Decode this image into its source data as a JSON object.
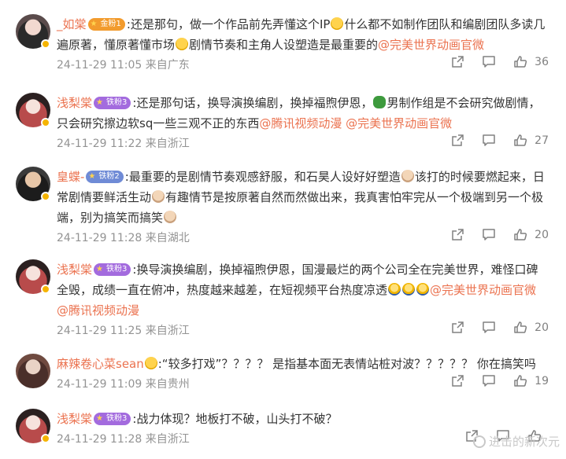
{
  "comments": [
    {
      "user": "_如棠",
      "badge": "金粉1",
      "badge_color": "#f29b2d",
      "segments": [
        {
          "t": ":还是那句，做一个作品前先弄懂这个IP"
        },
        {
          "e": "cry-icon"
        },
        {
          "t": "什么都不如制作团队和编剧团队多读几遍原著，懂原著懂市场"
        },
        {
          "e": "sad-icon"
        },
        {
          "t": "剧情节奏和主角人设塑造是最重要的"
        },
        {
          "m": "@完美世界动画官微"
        }
      ],
      "time": "24-11-29 11:05 来自广东",
      "likes": "36"
    },
    {
      "user": "浅梨棠",
      "badge": "铁粉3",
      "badge_color": "#a36bde",
      "segments": [
        {
          "t": ":还是那句话，换导演换编剧，换掉福煦伊恩，"
        },
        {
          "e": "turtle-icon"
        },
        {
          "t": "男制作组是不会研究做剧情，只会研究擦边软sq一些三观不正的东西"
        },
        {
          "m": "@腾讯视频动漫"
        },
        {
          "t": " "
        },
        {
          "m": "@完美世界动画官微"
        }
      ],
      "time": "24-11-29 11:22 来自浙江",
      "likes": "27"
    },
    {
      "user": "皇蝶-",
      "badge": "铁粉2",
      "badge_color": "#6f8bd6",
      "segments": [
        {
          "t": ":最重要的是剧情节奏观感舒服，和石昊人设好好塑造"
        },
        {
          "e": "old-man-icon"
        },
        {
          "t": "该打的时候要燃起来，日常剧情要鲜活生动"
        },
        {
          "e": "old-man-icon"
        },
        {
          "t": "有趣情节是按原著自然而然做出来，我真害怕牢完从一个极端到另一个极端，别为搞笑而搞笑"
        },
        {
          "e": "old-man-icon"
        }
      ],
      "time": "24-11-29 11:28 来自湖北",
      "likes": "20"
    },
    {
      "user": "浅梨棠",
      "badge": "铁粉3",
      "badge_color": "#a36bde",
      "segments": [
        {
          "t": ":换导演换编剧，换掉福煦伊恩，国漫最烂的两个公司全在完美世界，难怪口碑全毁，成绩一直在俯冲，热度越来越差，在短视频平台热度凉透"
        },
        {
          "e": "bald-icon"
        },
        {
          "e": "bald-icon"
        },
        {
          "e": "bald-icon"
        },
        {
          "m": "@完美世界动画官微"
        },
        {
          "t": " "
        },
        {
          "m": "@腾讯视频动漫"
        }
      ],
      "time": "24-11-29 11:25 来自浙江",
      "likes": "20"
    },
    {
      "user": "麻辣卷心菜sean",
      "segments": [
        {
          "e": "cry-icon"
        },
        {
          "t": ":“较多打戏”？？？？ 是指基本面无表情站桩对波？？？？？ 你在搞笑吗"
        }
      ],
      "time": "24-11-29 11:09 来自贵州",
      "likes": "19"
    },
    {
      "user": "浅梨棠",
      "badge": "铁粉3",
      "badge_color": "#a36bde",
      "segments": [
        {
          "t": ":战力体现？地板打不破，山头打不破？"
        }
      ],
      "time": "24-11-29 11:28 来自浙江",
      "likes": ""
    }
  ],
  "watermark": "进击的新次元",
  "colors": {
    "accent": "#eb7350",
    "meta": "#939393"
  }
}
